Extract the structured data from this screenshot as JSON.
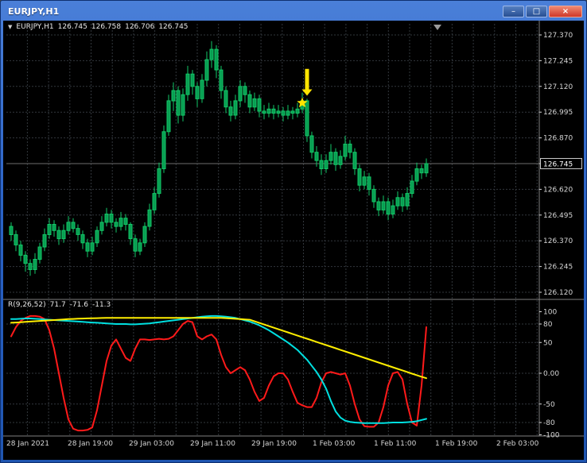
{
  "window": {
    "title": "EURJPY,H1",
    "controls": [
      {
        "name": "minimize",
        "glyph": "–"
      },
      {
        "name": "maximize",
        "glyph": "□"
      },
      {
        "name": "close",
        "glyph": "×"
      }
    ]
  },
  "main_header": {
    "collapse_glyph": "▼",
    "symbol_period": "EURJPY,H1",
    "open": "126.745",
    "high": "126.758",
    "low": "126.706",
    "close": "126.745"
  },
  "indicator_header": {
    "name": "R(9,26,52)",
    "values": [
      "71.7",
      "-71.6",
      "-11.3"
    ]
  },
  "colors": {
    "background": "#000000",
    "grid": "#32373d",
    "candle_fill": "#089e52",
    "candle_stroke": "#12c767",
    "axis_text": "#d6d6d6",
    "separator": "#818181",
    "current_price_line": "#6e6e6e",
    "red_line": "#ff1a1a",
    "cyan_line": "#00e0e0",
    "yellow_line": "#ffee00",
    "object_yellow": "#ffe400"
  },
  "chart_data": [
    {
      "type": "candlestick",
      "symbol": "EURJPY",
      "timeframe": "H1",
      "ylim": [
        126.12,
        127.37
      ],
      "y_ticks": [
        "127.370",
        "127.245",
        "127.120",
        "126.995",
        "126.870",
        "126.745",
        "126.620",
        "126.495",
        "126.370",
        "126.245",
        "126.120"
      ],
      "current_price": "126.745",
      "x_ticks": [
        "28 Jan 2021",
        "28 Jan 19:00",
        "29 Jan 03:00",
        "29 Jan 11:00",
        "29 Jan 19:00",
        "1 Feb 03:00",
        "1 Feb 11:00",
        "1 Feb 19:00",
        "2 Feb 03:00"
      ],
      "ohlc": [
        [
          126.44,
          126.46,
          126.37,
          126.4
        ],
        [
          126.4,
          126.42,
          126.32,
          126.35
        ],
        [
          126.35,
          126.37,
          126.27,
          126.3
        ],
        [
          126.3,
          126.32,
          126.22,
          126.26
        ],
        [
          126.26,
          126.28,
          126.2,
          126.23
        ],
        [
          126.23,
          126.31,
          126.21,
          126.28
        ],
        [
          126.28,
          126.36,
          126.26,
          126.34
        ],
        [
          126.34,
          126.43,
          126.32,
          126.4
        ],
        [
          126.4,
          126.48,
          126.38,
          126.45
        ],
        [
          126.45,
          126.47,
          126.39,
          126.42
        ],
        [
          126.42,
          126.44,
          126.35,
          126.38
        ],
        [
          126.38,
          126.45,
          126.36,
          126.42
        ],
        [
          126.42,
          126.49,
          126.4,
          126.46
        ],
        [
          126.46,
          126.48,
          126.41,
          126.43
        ],
        [
          126.43,
          126.45,
          126.37,
          126.4
        ],
        [
          126.4,
          126.42,
          126.33,
          126.36
        ],
        [
          126.36,
          126.38,
          126.29,
          126.32
        ],
        [
          126.32,
          126.39,
          126.3,
          126.36
        ],
        [
          126.36,
          126.44,
          126.34,
          126.42
        ],
        [
          126.42,
          126.49,
          126.4,
          126.46
        ],
        [
          126.46,
          126.53,
          126.44,
          126.5
        ],
        [
          126.5,
          126.52,
          126.43,
          126.46
        ],
        [
          126.46,
          126.48,
          126.41,
          126.44
        ],
        [
          126.44,
          126.51,
          126.42,
          126.48
        ],
        [
          126.48,
          126.5,
          126.42,
          126.45
        ],
        [
          126.45,
          126.46,
          126.35,
          126.38
        ],
        [
          126.38,
          126.4,
          126.29,
          126.32
        ],
        [
          126.32,
          126.38,
          126.3,
          126.36
        ],
        [
          126.36,
          126.46,
          126.34,
          126.44
        ],
        [
          126.44,
          126.55,
          126.42,
          126.52
        ],
        [
          126.52,
          126.63,
          126.5,
          126.6
        ],
        [
          126.6,
          126.75,
          126.58,
          126.72
        ],
        [
          126.72,
          126.93,
          126.7,
          126.9
        ],
        [
          126.9,
          127.08,
          126.88,
          127.05
        ],
        [
          127.05,
          127.14,
          127.0,
          127.1
        ],
        [
          127.1,
          127.12,
          126.94,
          126.98
        ],
        [
          126.98,
          127.11,
          126.95,
          127.08
        ],
        [
          127.08,
          127.22,
          127.05,
          127.18
        ],
        [
          127.18,
          127.2,
          127.08,
          127.12
        ],
        [
          127.12,
          127.14,
          127.02,
          127.06
        ],
        [
          127.06,
          127.18,
          127.04,
          127.15
        ],
        [
          127.15,
          127.29,
          127.12,
          127.25
        ],
        [
          127.25,
          127.34,
          127.21,
          127.3
        ],
        [
          127.3,
          127.32,
          127.16,
          127.2
        ],
        [
          127.2,
          127.22,
          127.06,
          127.1
        ],
        [
          127.1,
          127.12,
          126.99,
          127.02
        ],
        [
          127.02,
          127.05,
          126.95,
          126.98
        ],
        [
          126.98,
          127.08,
          126.96,
          127.05
        ],
        [
          127.05,
          127.15,
          127.02,
          127.12
        ],
        [
          127.12,
          127.14,
          127.04,
          127.08
        ],
        [
          127.08,
          127.1,
          126.99,
          127.02
        ],
        [
          127.02,
          127.09,
          127.0,
          127.06
        ],
        [
          127.06,
          127.08,
          126.97,
          127.0
        ],
        [
          127.0,
          127.03,
          126.96,
          126.99
        ],
        [
          126.99,
          127.04,
          126.97,
          127.01
        ],
        [
          127.01,
          127.03,
          126.96,
          126.99
        ],
        [
          126.99,
          127.03,
          126.97,
          127.0
        ],
        [
          127.0,
          127.02,
          126.95,
          126.98
        ],
        [
          126.98,
          127.03,
          126.96,
          127.0
        ],
        [
          127.0,
          127.02,
          126.96,
          126.99
        ],
        [
          126.99,
          127.04,
          126.97,
          127.01
        ],
        [
          127.01,
          127.09,
          126.99,
          127.05
        ],
        [
          127.05,
          127.06,
          126.85,
          126.88
        ],
        [
          126.88,
          126.9,
          126.77,
          126.8
        ],
        [
          126.8,
          126.83,
          126.73,
          126.76
        ],
        [
          126.76,
          126.79,
          126.69,
          126.72
        ],
        [
          126.72,
          126.79,
          126.7,
          126.76
        ],
        [
          126.76,
          126.84,
          126.74,
          126.8
        ],
        [
          126.8,
          126.82,
          126.71,
          126.74
        ],
        [
          126.74,
          126.81,
          126.72,
          126.78
        ],
        [
          126.78,
          126.88,
          126.76,
          126.84
        ],
        [
          126.84,
          126.86,
          126.77,
          126.8
        ],
        [
          126.8,
          126.82,
          126.69,
          126.72
        ],
        [
          126.72,
          126.74,
          126.61,
          126.64
        ],
        [
          126.64,
          126.71,
          126.62,
          126.68
        ],
        [
          126.68,
          126.7,
          126.59,
          126.62
        ],
        [
          126.62,
          126.64,
          126.53,
          126.56
        ],
        [
          126.56,
          126.58,
          126.49,
          126.52
        ],
        [
          126.52,
          126.59,
          126.5,
          126.56
        ],
        [
          126.56,
          126.58,
          126.47,
          126.5
        ],
        [
          126.5,
          126.57,
          126.48,
          126.54
        ],
        [
          126.54,
          126.61,
          126.52,
          126.58
        ],
        [
          126.58,
          126.6,
          126.51,
          126.54
        ],
        [
          126.54,
          126.63,
          126.52,
          126.6
        ],
        [
          126.6,
          126.69,
          126.58,
          126.66
        ],
        [
          126.66,
          126.75,
          126.64,
          126.72
        ],
        [
          126.72,
          126.74,
          126.67,
          126.7
        ],
        [
          126.7,
          126.77,
          126.68,
          126.745
        ]
      ]
    },
    {
      "type": "line",
      "title": "R(9,26,52)",
      "ylim": [
        -110,
        115
      ],
      "y_ticks": [
        {
          "label": "100",
          "value": 100
        },
        {
          "label": "80",
          "value": 80
        },
        {
          "label": "50",
          "value": 50
        },
        {
          "label": "0.00",
          "value": 0
        },
        {
          "label": "-50",
          "value": -50
        },
        {
          "label": "-80",
          "value": -80
        },
        {
          "label": "-100",
          "value": -100
        }
      ],
      "levels": [
        80,
        50,
        0,
        -50,
        -80
      ],
      "series": [
        {
          "name": "fast",
          "color_key": "red_line",
          "values": [
            60,
            75,
            85,
            90,
            93,
            93,
            92,
            88,
            70,
            40,
            0,
            -40,
            -75,
            -90,
            -93,
            -93,
            -92,
            -88,
            -60,
            -20,
            20,
            45,
            55,
            40,
            25,
            20,
            40,
            55,
            55,
            54,
            55,
            56,
            55,
            56,
            60,
            70,
            80,
            85,
            83,
            60,
            55,
            60,
            63,
            55,
            30,
            10,
            0,
            5,
            10,
            5,
            -10,
            -30,
            -45,
            -40,
            -20,
            -5,
            0,
            0,
            -10,
            -30,
            -48,
            -52,
            -55,
            -55,
            -40,
            -15,
            0,
            2,
            0,
            -2,
            0,
            -20,
            -50,
            -75,
            -86,
            -87,
            -87,
            -80,
            -55,
            -20,
            0,
            2,
            -10,
            -50,
            -80,
            -85,
            -20,
            75
          ]
        },
        {
          "name": "medium",
          "color_key": "cyan_line",
          "values": [
            88,
            88,
            88.5,
            89,
            89,
            88.5,
            88,
            87.5,
            87,
            86.5,
            86,
            85.5,
            85,
            84.5,
            84,
            83.5,
            83,
            82.5,
            82,
            81.5,
            81,
            80.5,
            80,
            80,
            80,
            79.5,
            79.5,
            80,
            80.5,
            81,
            82,
            83,
            84,
            85,
            86,
            87,
            88,
            89,
            90,
            91,
            92,
            92.5,
            93,
            93,
            92.5,
            92,
            91,
            90,
            88,
            86,
            84,
            81,
            78,
            74,
            70,
            65,
            60,
            55,
            50,
            44,
            38,
            30,
            22,
            12,
            2,
            -10,
            -25,
            -45,
            -62,
            -72,
            -77,
            -79,
            -80,
            -80.5,
            -81,
            -81,
            -81,
            -81,
            -81,
            -80.5,
            -80,
            -80,
            -80,
            -79.5,
            -79,
            -78,
            -76,
            -74
          ]
        },
        {
          "name": "slow",
          "color_key": "yellow_line",
          "values": [
            82,
            82.5,
            83,
            83.5,
            84,
            84.5,
            85,
            85.5,
            86,
            86.5,
            87,
            87.5,
            88,
            88.3,
            88.6,
            88.9,
            89.2,
            89.4,
            89.6,
            89.8,
            90,
            90,
            90,
            90,
            90,
            90,
            90,
            90,
            90,
            90,
            90,
            90,
            90,
            90,
            90,
            90,
            90,
            90,
            90,
            90,
            90,
            90,
            90,
            90,
            90,
            89.5,
            89,
            88.5,
            88,
            87.5,
            87,
            84.4,
            81.8,
            79.2,
            76.7,
            74.1,
            71.5,
            68.9,
            66.4,
            63.8,
            61.2,
            58.6,
            56.1,
            53.5,
            50.9,
            48.3,
            45.8,
            43.2,
            40.6,
            38,
            35.5,
            32.9,
            30.3,
            27.7,
            25.2,
            22.6,
            20,
            17.4,
            14.9,
            12.3,
            9.7,
            7.1,
            4.6,
            2,
            -0.6,
            -3.1,
            -5.7,
            -8
          ]
        }
      ]
    }
  ],
  "objects": [
    {
      "name": "sell-arrow",
      "shape": "arrow-down",
      "bar": 62,
      "price_top": 127.205,
      "price_tip": 127.075
    },
    {
      "name": "sell-star",
      "shape": "star",
      "bar": 61,
      "price": 127.04
    }
  ]
}
